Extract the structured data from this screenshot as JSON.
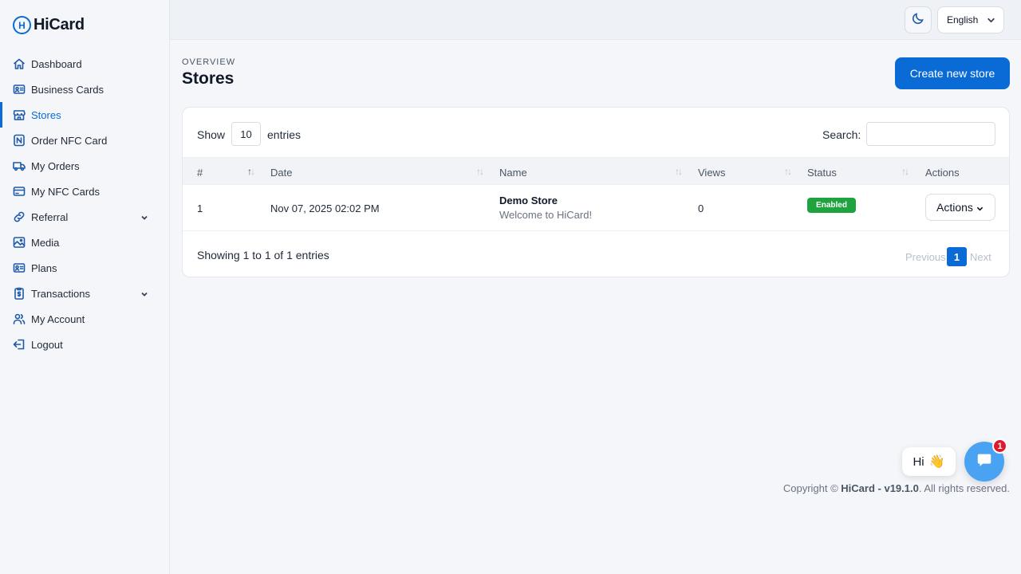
{
  "brand": {
    "name": "HiCard",
    "mark": "H"
  },
  "sidebar": {
    "items": [
      {
        "label": "Dashboard",
        "icon": "home-icon"
      },
      {
        "label": "Business Cards",
        "icon": "id-card-icon"
      },
      {
        "label": "Stores",
        "icon": "store-icon",
        "active": true
      },
      {
        "label": "Order NFC Card",
        "icon": "nfc-icon"
      },
      {
        "label": "My Orders",
        "icon": "truck-icon"
      },
      {
        "label": "My NFC Cards",
        "icon": "card-icon"
      },
      {
        "label": "Referral",
        "icon": "link-icon",
        "has_submenu": true
      },
      {
        "label": "Media",
        "icon": "image-icon"
      },
      {
        "label": "Plans",
        "icon": "id-card-icon"
      },
      {
        "label": "Transactions",
        "icon": "receipt-icon",
        "has_submenu": true
      },
      {
        "label": "My Account",
        "icon": "users-icon"
      },
      {
        "label": "Logout",
        "icon": "logout-icon"
      }
    ]
  },
  "topbar": {
    "theme_icon": "moon-icon",
    "language": "English"
  },
  "header": {
    "overline": "OVERVIEW",
    "title": "Stores",
    "create_label": "Create new store"
  },
  "table": {
    "show_label": "Show",
    "page_length": "10",
    "entries_label": "entries",
    "search_label": "Search:",
    "search_value": "",
    "columns": [
      "#",
      "Date",
      "Name",
      "Views",
      "Status",
      "Actions"
    ],
    "rows": [
      {
        "index": "1",
        "date": "Nov 07, 2025 02:02 PM",
        "name": "Demo Store",
        "description": "Welcome to HiCard!",
        "views": "0",
        "status": "Enabled",
        "actions_label": "Actions"
      }
    ],
    "info": "Showing 1 to 1 of 1 entries",
    "pagination": {
      "previous": "Previous",
      "current": "1",
      "next": "Next"
    }
  },
  "footer": {
    "prefix": "Copyright © ",
    "brand": "HiCard - v19.1.0",
    "suffix": ". All rights reserved."
  },
  "chat": {
    "greeting": "Hi",
    "wave": "👋",
    "unread": "1"
  },
  "colors": {
    "accent": "#0a6bd6",
    "success": "#1fa33f",
    "chat": "#4aa3f2",
    "notification": "#e0182d"
  }
}
